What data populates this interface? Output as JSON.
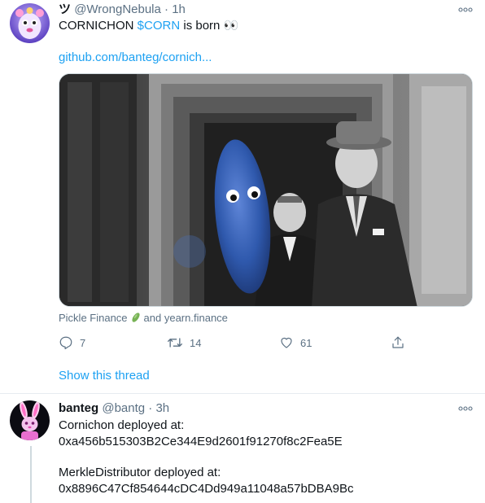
{
  "tweet1": {
    "display_name": "ツ",
    "handle": "@WrongNebula",
    "separator": "·",
    "time": "1h",
    "text_before": "CORNICHON ",
    "cashtag": "$CORN",
    "text_after": " is born 👀",
    "link": "github.com/banteg/cornich...",
    "caption_part1": "Pickle Finance",
    "caption_part2": "and yearn.finance",
    "replies": "7",
    "retweets": "14",
    "likes": "61",
    "show_thread": "Show this thread"
  },
  "tweet2": {
    "display_name": "banteg",
    "handle": "@bantg",
    "separator": "·",
    "time": "3h",
    "line1": "Cornichon deployed at:",
    "line2": "0xa456b515303B2Ce344E9d2601f91270f8c2Fea5E",
    "line3": "MerkleDistributor deployed at:",
    "line4": "0x8896C47Cf854644cDC4Dd949a11048a57bDBA9Bc"
  },
  "icons": {
    "reply": "reply-icon",
    "retweet": "retweet-icon",
    "like": "like-icon",
    "share": "share-icon",
    "more": "more-icon",
    "pickle": "pickle-icon"
  },
  "colors": {
    "accent": "#1da1f2",
    "secondary_text": "#5b7083",
    "primary_text": "#0f1419",
    "divider": "#e6ecf0"
  }
}
